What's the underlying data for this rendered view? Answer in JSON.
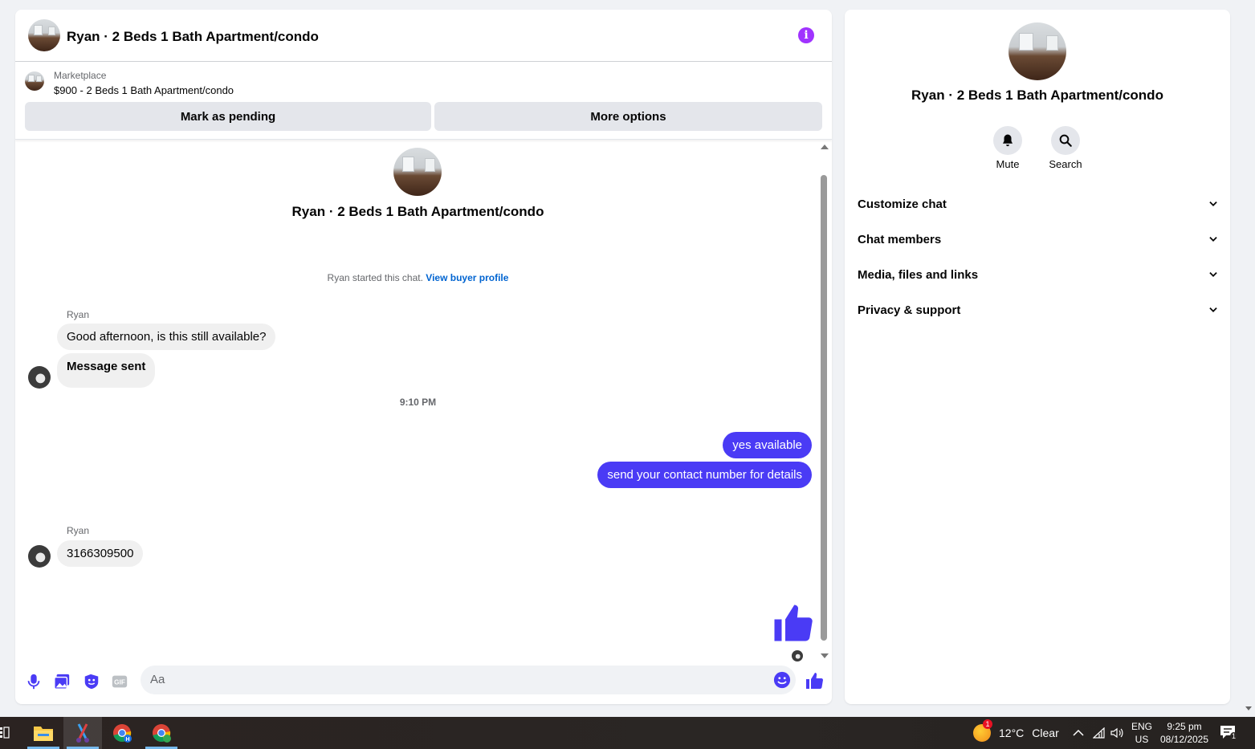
{
  "header": {
    "title": "Ryan · 2 Beds 1 Bath Apartment/condo",
    "info_icon": "info-icon"
  },
  "marketplace": {
    "label": "Marketplace",
    "listing": "$900 - 2 Beds 1 Bath Apartment/condo",
    "mark_pending": "Mark as pending",
    "more_options": "More options"
  },
  "conversation": {
    "name": "Ryan · 2 Beds 1 Bath Apartment/condo",
    "started_text": "Ryan started this chat. ",
    "view_profile": "View buyer profile",
    "messages": [
      {
        "sender": "Ryan",
        "text": "Good afternoon, is this still available?"
      },
      {
        "text": "Message sent"
      },
      {
        "timestamp": "9:10 PM"
      },
      {
        "outgoing": true,
        "text": "yes available"
      },
      {
        "outgoing": true,
        "text": "send your contact number for details"
      },
      {
        "sender": "Ryan",
        "text": "3166309500"
      }
    ]
  },
  "composer": {
    "placeholder": "Aa"
  },
  "details": {
    "name": "Ryan · 2 Beds 1 Bath Apartment/condo",
    "mute": "Mute",
    "search": "Search",
    "sections": [
      "Customize chat",
      "Chat members",
      "Media, files and links",
      "Privacy & support"
    ]
  },
  "taskbar": {
    "weather_badge": "1",
    "temperature": "12°C",
    "condition": "Clear",
    "lang_top": "ENG",
    "lang_bottom": "US",
    "time": "9:25 pm",
    "date": "08/12/2025",
    "notif_count": "1"
  },
  "colors": {
    "accent": "#4a3bf5",
    "info": "#a033ff",
    "link": "#0064d1"
  }
}
